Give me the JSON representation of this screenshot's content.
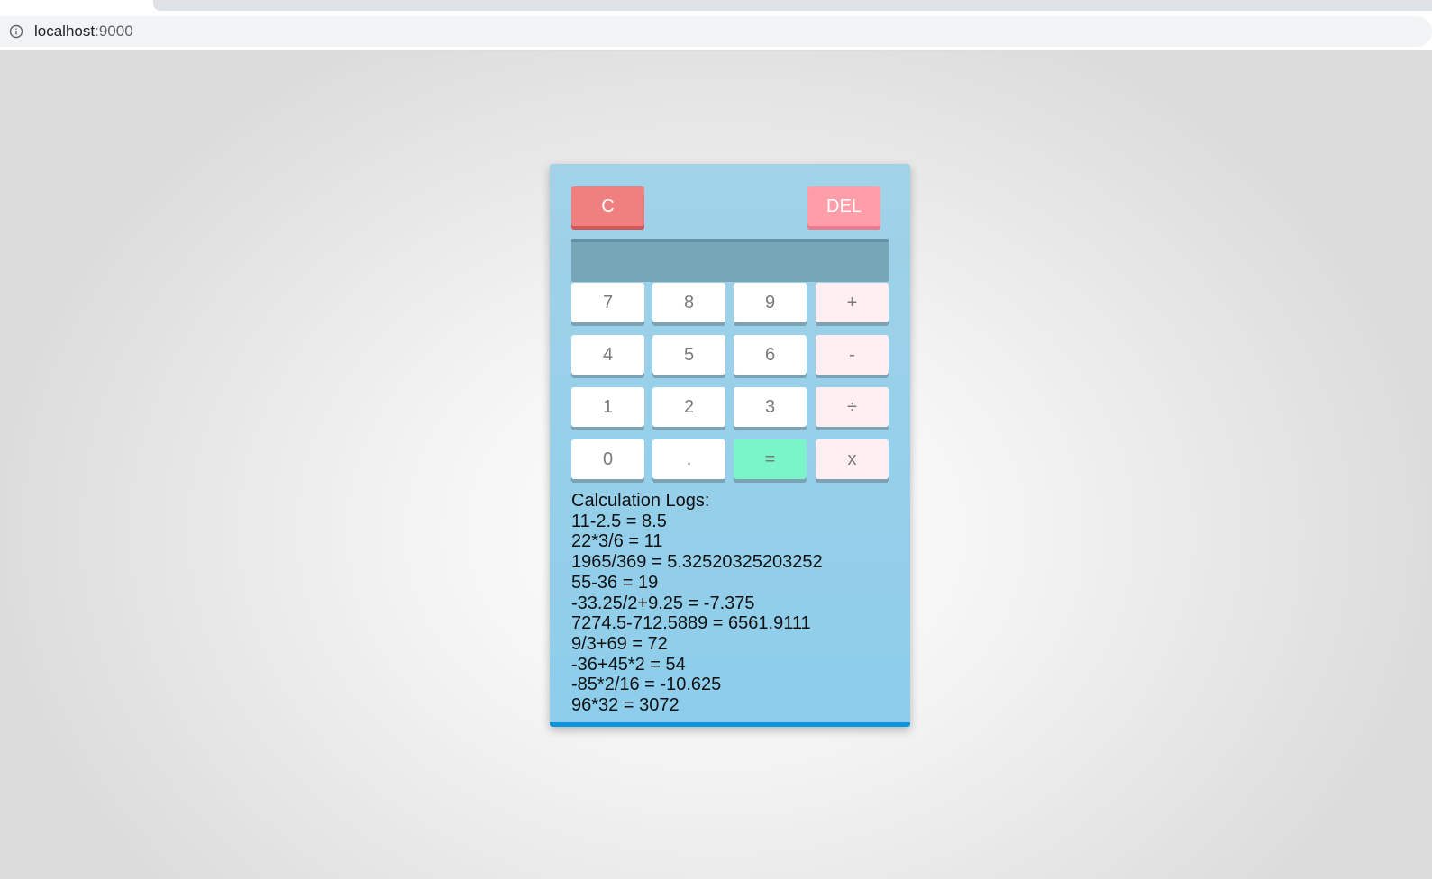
{
  "browser": {
    "url_host": "localhost",
    "url_port": ":9000"
  },
  "calculator": {
    "clear_label": "C",
    "delete_label": "DEL",
    "display_value": "",
    "keys": {
      "k7": "7",
      "k8": "8",
      "k9": "9",
      "plus": "+",
      "k4": "4",
      "k5": "5",
      "k6": "6",
      "minus": "-",
      "k1": "1",
      "k2": "2",
      "k3": "3",
      "divide": "÷",
      "k0": "0",
      "dot": ".",
      "equals": "=",
      "multiply": "x"
    },
    "colors": {
      "panel": "#8dcdeb",
      "clear": "#f07f7f",
      "delete": "#ff9ea9",
      "equals": "#7af5c9",
      "operator": "#ffeef2",
      "display": "#77a6b9"
    }
  },
  "logs": {
    "title": "Calculation Logs:",
    "entries": [
      "11-2.5 = 8.5",
      "22*3/6 = 11",
      "1965/369 = 5.32520325203252",
      "55-36 = 19",
      "-33.25/2+9.25 = -7.375",
      "7274.5-712.5889 = 6561.9111",
      "9/3+69 = 72",
      "-36+45*2 = 54",
      "-85*2/16 = -10.625",
      "96*32 = 3072"
    ]
  }
}
